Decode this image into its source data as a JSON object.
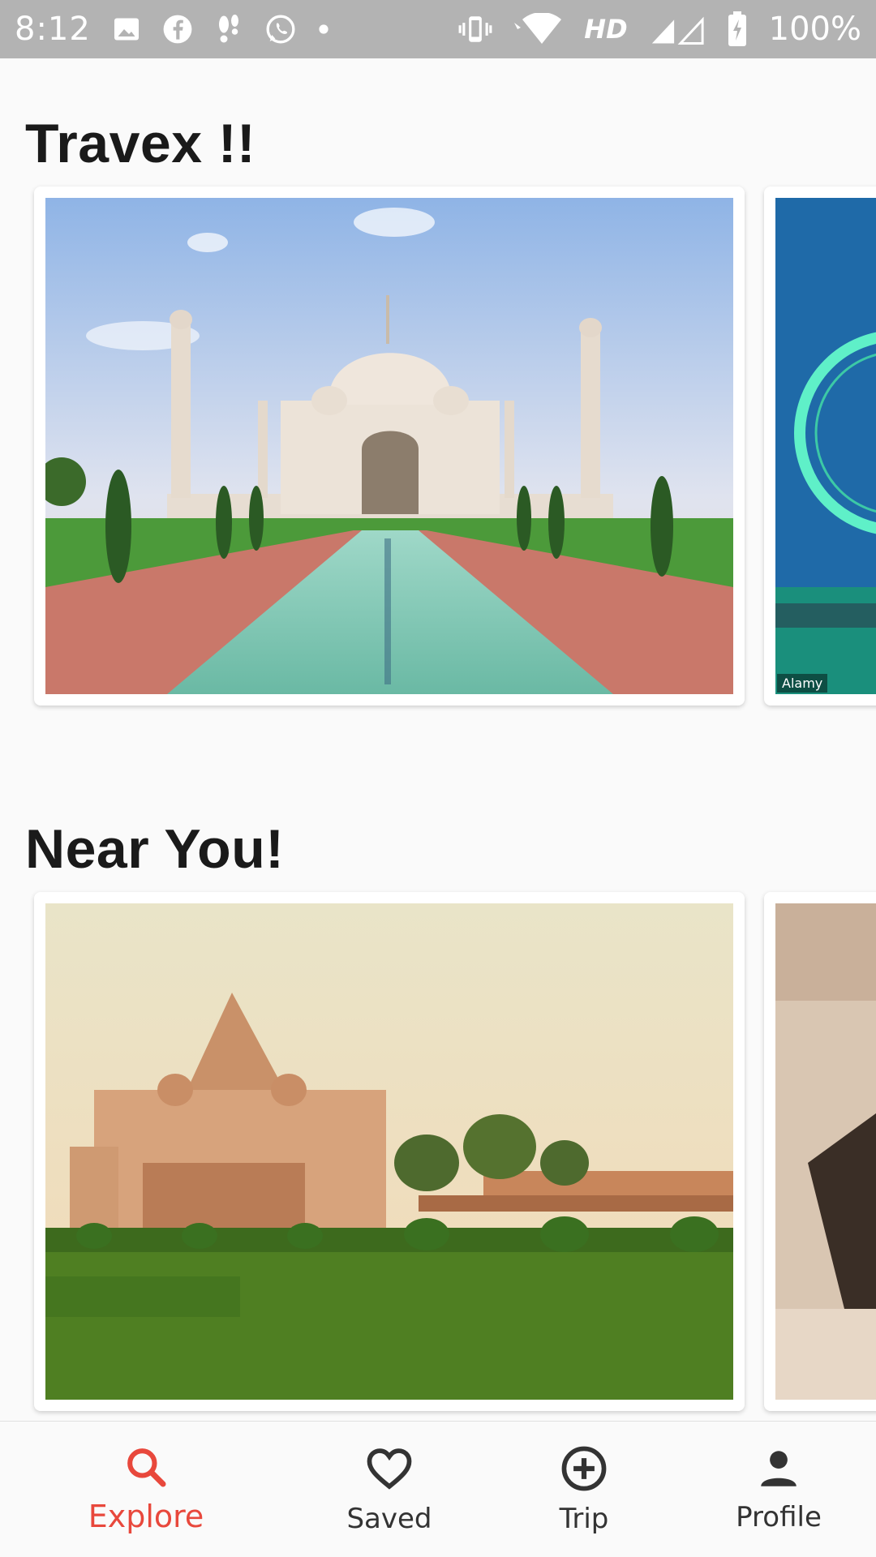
{
  "status_bar": {
    "time": "8:12",
    "network": "HD",
    "battery": "100%"
  },
  "sections": [
    {
      "title": "Travex !!"
    },
    {
      "title": "Near You!"
    }
  ],
  "watermark": "Alamy",
  "bottom_nav": {
    "items": [
      {
        "label": "Explore",
        "icon": "search-icon",
        "active": true
      },
      {
        "label": "Saved",
        "icon": "heart-icon",
        "active": false
      },
      {
        "label": "Trip",
        "icon": "add-circle-icon",
        "active": false
      },
      {
        "label": "Profile",
        "icon": "person-icon",
        "active": false
      }
    ]
  },
  "colors": {
    "accent": "#e8483c",
    "status_bar": "#b3b3b3"
  }
}
